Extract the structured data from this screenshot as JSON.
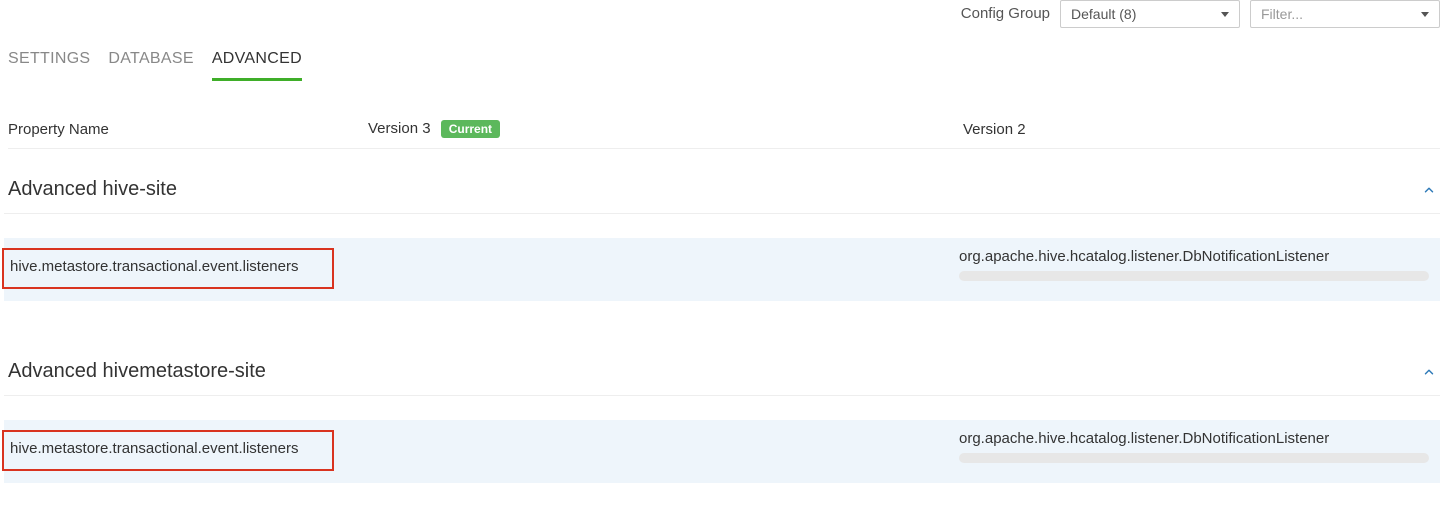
{
  "header": {
    "config_group_label": "Config Group",
    "config_group_value": "Default (8)",
    "filter_placeholder": "Filter..."
  },
  "tabs": {
    "settings": "SETTINGS",
    "database": "DATABASE",
    "advanced": "ADVANCED"
  },
  "columns": {
    "property_name": "Property Name",
    "version_current": "Version 3",
    "current_badge": "Current",
    "version_prev": "Version 2"
  },
  "sections": [
    {
      "title": "Advanced hive-site",
      "rows": [
        {
          "name": "hive.metastore.transactional.event.listeners",
          "v3": "",
          "v2": "org.apache.hive.hcatalog.listener.DbNotificationListener"
        }
      ]
    },
    {
      "title": "Advanced hivemetastore-site",
      "rows": [
        {
          "name": "hive.metastore.transactional.event.listeners",
          "v3": "",
          "v2": "org.apache.hive.hcatalog.listener.DbNotificationListener"
        }
      ]
    }
  ]
}
